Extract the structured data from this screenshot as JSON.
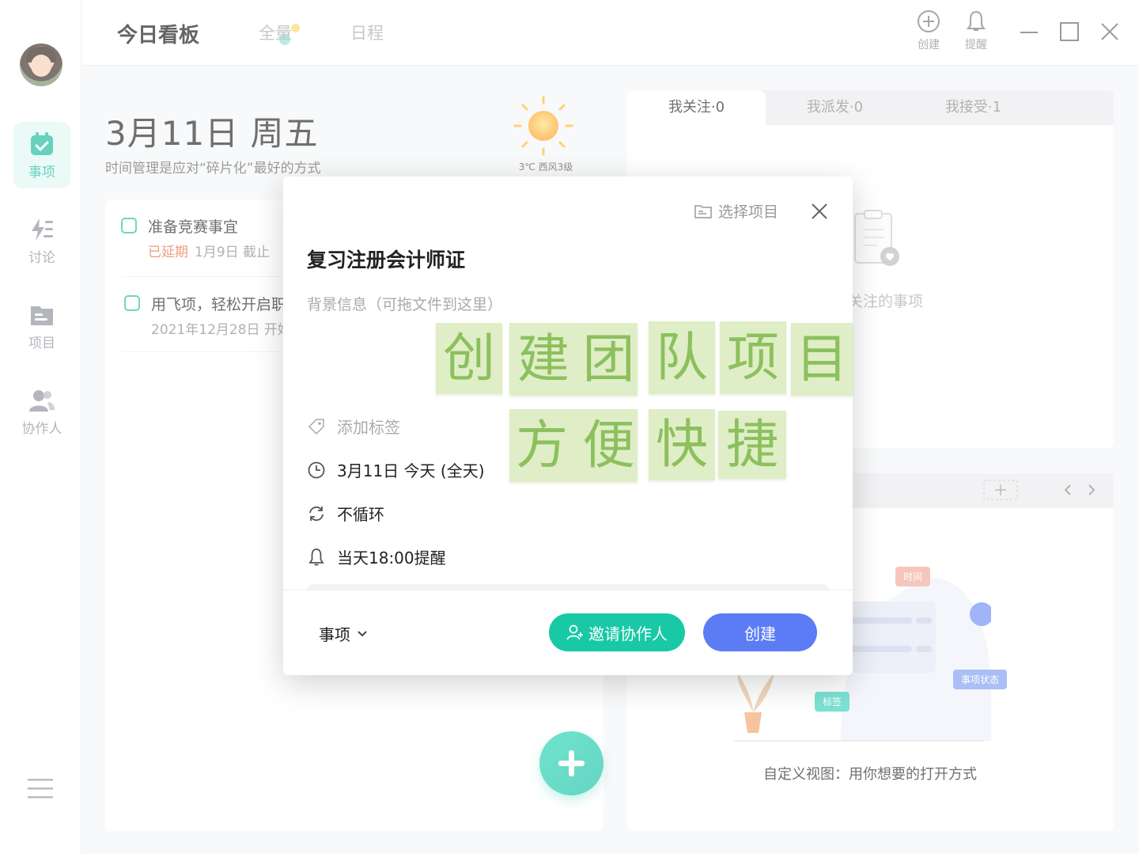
{
  "topbar": {
    "tabs": [
      {
        "label": "今日看板",
        "active": true
      },
      {
        "label": "全量",
        "active": false
      },
      {
        "label": "日程",
        "active": false
      }
    ],
    "actions": [
      {
        "label": "创建",
        "icon": "plus-circle-icon"
      },
      {
        "label": "提醒",
        "icon": "bell-icon"
      }
    ]
  },
  "sidebar": {
    "items": [
      {
        "label": "事项",
        "icon": "calendar-check-icon",
        "active": true
      },
      {
        "label": "讨论",
        "icon": "lightning-list-icon",
        "active": false
      },
      {
        "label": "项目",
        "icon": "folder-icon",
        "active": false
      },
      {
        "label": "协作人",
        "icon": "people-icon",
        "active": false
      }
    ]
  },
  "today": {
    "date": "3月11日 周五",
    "subtitle": "时间管理是应对“碎片化”最好的方式",
    "weather": "3℃ 西风3级"
  },
  "tasks": [
    {
      "title": "准备竞赛事宜",
      "status": "已延期",
      "meta": "1月9日 截止"
    },
    {
      "title": "用飞项，轻松开启职",
      "status": "",
      "meta": "2021年12月28日 开始"
    }
  ],
  "right_panel": {
    "tabs": [
      {
        "label": "我关注·0",
        "active": true
      },
      {
        "label": "我派发·0",
        "active": false
      },
      {
        "label": "我接受·1",
        "active": false
      }
    ],
    "empty_text": "关注的事项",
    "custom_view_text": "自定义视图：用你想要的打开方式",
    "chips": {
      "time": "时间",
      "status": "事项状态",
      "tag": "标签"
    }
  },
  "modal": {
    "select_project": "选择项目",
    "title": "复习注册会计师证",
    "description_placeholder": "背景信息（可拖文件到这里）",
    "add_tag": "添加标签",
    "date": "3月11日 今天 (全天)",
    "repeat": "不循环",
    "reminder": "当天18:00提醒",
    "type": "事项",
    "invite_label": "邀请协作人",
    "create_label": "创建"
  },
  "banner": {
    "line1": [
      "创",
      "建",
      "团",
      "队",
      "项",
      "目"
    ],
    "line2": [
      "方",
      "便",
      "快",
      "捷"
    ]
  },
  "colors": {
    "accent": "#19c9a6",
    "primary_button": "#5b7cf5",
    "overdue": "#e0693f",
    "sticky_bg": "#dfeec6",
    "sticky_text": "#8cc05e"
  }
}
